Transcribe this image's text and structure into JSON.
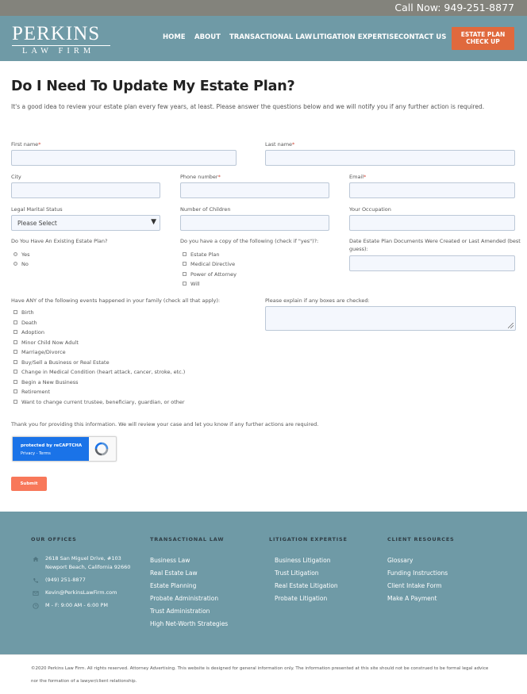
{
  "topbar": {
    "call_now": "Call Now: 949-251-8877"
  },
  "header": {
    "logo_name": "PERKINS",
    "logo_sub": "LAW FIRM",
    "nav": [
      "HOME",
      "ABOUT",
      "TRANSACTIONAL LAW",
      "LITIGATION EXPERTISE",
      "CONTACT US"
    ],
    "cta_line1": "ESTATE PLAN",
    "cta_line2": "CHECK UP"
  },
  "page": {
    "title": "Do I Need To Update My Estate Plan?",
    "intro": "It's a good idea to review your estate plan every few years, at least. Please answer the questions below and we will notify you if any further action is required."
  },
  "form": {
    "first_name": "First name",
    "last_name": "Last name",
    "city": "City",
    "phone": "Phone number",
    "email": "Email",
    "marital_status": "Legal Marital Status",
    "marital_select": "Please Select",
    "num_children": "Number of Children",
    "occupation": "Your Occupation",
    "existing_plan_q": "Do You Have An Existing Estate Plan?",
    "existing_plan_options": [
      "Yes",
      "No"
    ],
    "copy_q": "Do you have a copy of the following (check if \"yes\")?:",
    "copy_options": [
      "Estate Plan",
      "Medical Directive",
      "Power of Attorney",
      "Will"
    ],
    "date_q_line1": "Date Estate Plan Documents Were Created or Last Amended (best",
    "date_q_line2": "guess):",
    "events_q": "Have ANY of the following events happened in your family (check all that apply):",
    "events_options": [
      "Birth",
      "Death",
      "Adoption",
      "Minor Child Now Adult",
      "Marriage/Divorce",
      "Buy/Sell a Business or Real Estate",
      "Change in Medical Condition (heart attack, cancer, stroke, etc.)",
      "Begin a New Business",
      "Retirement",
      "Want to change current trustee, beneficiary, guardian, or other"
    ],
    "explain_q": "Please explain if any boxes are checked:",
    "thanks": "Thank you for providing this information. We will review your case and let you know if any further actions are required.",
    "captcha_line1": "protected by reCAPTCHA",
    "captcha_line2": "Privacy - Terms",
    "submit": "Submit"
  },
  "footer": {
    "offices_heading": "OUR OFFICES",
    "address_line1": "2618 San Miguel Drive, #103",
    "address_line2": "Newport Beach, California 92660",
    "phone": "(949) 251-8877",
    "email": "Kevin@PerkinsLawFirm.com",
    "hours": "M - F: 9:00 AM - 6:00 PM",
    "transactional_heading": "TRANSACTIONAL LAW",
    "transactional_links": [
      "Business Law",
      "Real Estate Law",
      "Estate Planning",
      "Probate Administration",
      "Trust Administration",
      "High Net-Worth Strategies"
    ],
    "litigation_heading": "LITIGATION EXPERTISE",
    "litigation_links": [
      "Business Litigation",
      "Trust Litigation",
      "Real Estate Litigation",
      "Probate Litigation"
    ],
    "resources_heading": "CLIENT RESOURCES",
    "resources_links": [
      "Glossary",
      "Funding Instructions",
      "Client Intake Form",
      "Make A Payment"
    ],
    "copyright_line1": "©2020 Perkins Law Firm. All rights reserved. Attorney Advertising. This website is designed for general information only. The information presented at this site should not be construed to be formal legal advice",
    "copyright_line2": "nor the formation of a lawyer/client relationship."
  },
  "colors": {
    "header_bg": "#6f9aa6",
    "cta_orange": "#e0693d",
    "submit_salmon": "#f8785a",
    "topbar_gray": "#83837c"
  }
}
